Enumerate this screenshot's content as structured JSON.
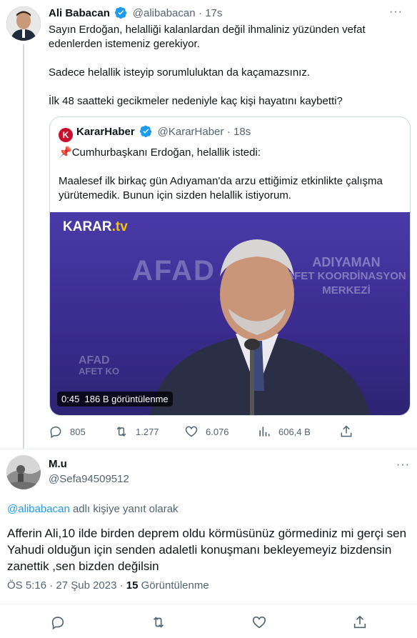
{
  "tweet": {
    "author_name": "Ali Babacan",
    "author_handle": "@alibabacan",
    "time": "· 17s",
    "more": "···",
    "paragraphs": [
      "Sayın Erdoğan, helalliği kalanlardan değil ihmaliniz yüzünden vefat edenlerden istemeniz gerekiyor.",
      "Sadece helallik isteyip sorumluluktan da kaçamazsınız.",
      "İlk 48 saatteki gecikmeler nedeniyle kaç kişi hayatını kaybetti?"
    ],
    "quote": {
      "logo_letter": "K",
      "author_name": "KararHaber",
      "author_handle": "@KararHaber",
      "time": "· 18s",
      "pin": "📌",
      "line1": "Cumhurbaşkanı Erdoğan, helallik istedi:",
      "line2": "Maalesef ilk birkaç gün Adıyaman'da arzu ettiğimiz etkinlikte çalışma yürütemedik. Bunun için sizden helallik istiyorum.",
      "video": {
        "brand": "KARAR",
        "brand_suffix": ".tv",
        "bg_big": "AFAD",
        "bg_text_1": "ADIYAMAN",
        "bg_text_2": "AFET KOORDİNASYON",
        "bg_text_3": "MERKEZİ",
        "bg_left_1": "AFAD",
        "bg_left_2": "AFET KO",
        "duration": "0:45",
        "views": "186 B görüntülenme"
      }
    },
    "actions": {
      "replies": "805",
      "retweets": "1.277",
      "likes": "6.076",
      "views": "606,4 B"
    }
  },
  "reply": {
    "author_name": "M.u",
    "author_handle": "@Sefa94509512",
    "more": "···",
    "reply_to_handle": "@alibabacan",
    "reply_to_suffix": " adlı kişiye yanıt olarak",
    "text": "Afferin Ali,10 ilde birden deprem oldu körmüsünüz görmediniz mi gerçi sen Yahudi olduğun için senden adaletli konuşmanı bekleyemeyiz bizdensin zanettik ,sen bizden değilsin",
    "timestamp": "ÖS 5:16 · 27 Şub 2023 · ",
    "view_count": "15",
    "view_label": " Görüntülenme"
  },
  "colors": {
    "accent": "#1d9bf0",
    "muted": "#536471",
    "text": "#0f1419",
    "border": "#cfd9de",
    "video_bg": "#3b2c8f",
    "karar_red": "#c8102e"
  }
}
